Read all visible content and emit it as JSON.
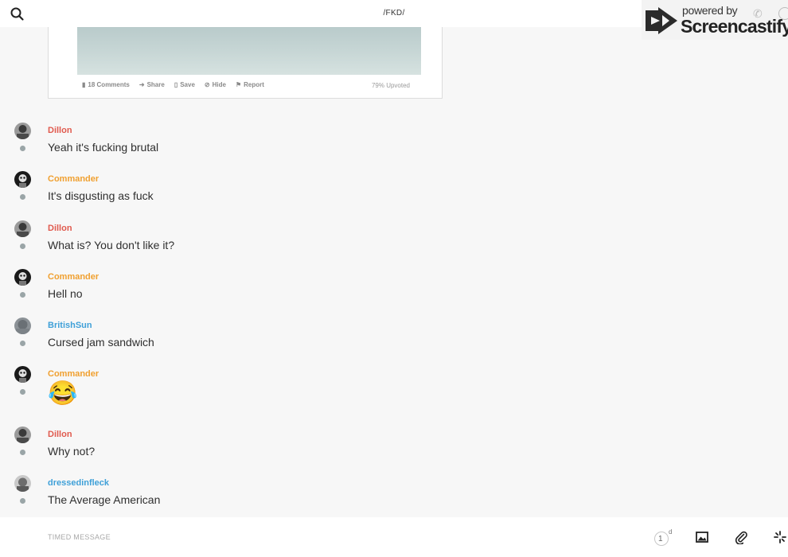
{
  "header": {
    "channel_title": "/FKD/",
    "search_icon": "search-icon"
  },
  "watermark": {
    "powered_by": "powered by",
    "brand": "Screencastify"
  },
  "preview": {
    "actions": [
      "18 Comments",
      "Share",
      "Save",
      "Hide",
      "Report"
    ],
    "upvoted": "79% Upvoted"
  },
  "messages": [
    {
      "user": "Dillon",
      "user_color": "#e05a4e",
      "text": "Yeah it's fucking brutal"
    },
    {
      "user": "Commander",
      "user_color": "#f0a030",
      "text": "It's disgusting as fuck"
    },
    {
      "user": "Dillon",
      "user_color": "#e05a4e",
      "text": "What is? You don't like it?"
    },
    {
      "user": "Commander",
      "user_color": "#f0a030",
      "text": "Hell no"
    },
    {
      "user": "BritishSun",
      "user_color": "#3fa0d8",
      "text": "Cursed jam sandwich"
    },
    {
      "user": "Commander",
      "user_color": "#f0a030",
      "text": "😂"
    },
    {
      "user": "Dillon",
      "user_color": "#e05a4e",
      "text": "Why not?"
    },
    {
      "user": "dressedinfleck",
      "user_color": "#3fa0d8",
      "text": "The Average American"
    }
  ],
  "composer": {
    "placeholder": "TIMED MESSAGE",
    "timer_value": "1",
    "timer_unit": "d"
  }
}
